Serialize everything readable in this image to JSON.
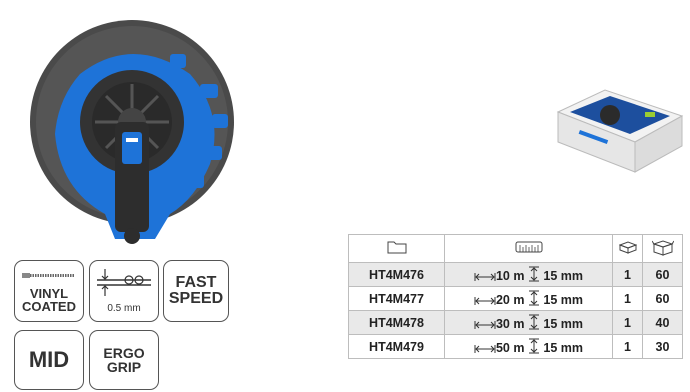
{
  "badges": {
    "vinyl": {
      "line1": "VINYL",
      "line2": "COATED"
    },
    "thickness": {
      "label": "0.5 mm"
    },
    "fast": {
      "line1": "FAST",
      "line2": "SPEED"
    },
    "mid": {
      "label": "MID"
    },
    "ergo": {
      "line1": "ERGO",
      "line2": "GRIP"
    }
  },
  "colors": {
    "accent": "#1e73d8",
    "dark": "#2b2b2b",
    "row_shade": "#e9e9e9"
  },
  "table": {
    "header_icons": [
      "folder-icon",
      "tape-scale-icon",
      "single-box-icon",
      "carton-box-icon"
    ],
    "rows": [
      {
        "code": "HT4M476",
        "length": "10 m",
        "width": "15 mm",
        "qty1": "1",
        "qty2": "60"
      },
      {
        "code": "HT4M477",
        "length": "20 m",
        "width": "15 mm",
        "qty1": "1",
        "qty2": "60"
      },
      {
        "code": "HT4M478",
        "length": "30 m",
        "width": "15 mm",
        "qty1": "1",
        "qty2": "40"
      },
      {
        "code": "HT4M479",
        "length": "50 m",
        "width": "15 mm",
        "qty1": "1",
        "qty2": "30"
      }
    ]
  }
}
